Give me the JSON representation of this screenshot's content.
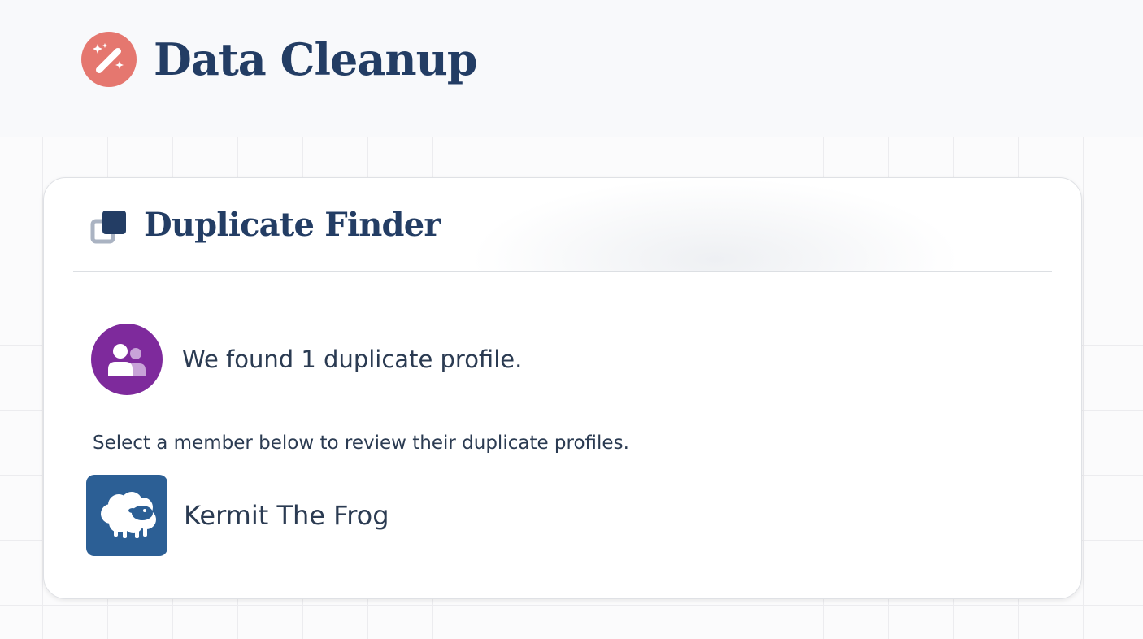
{
  "header": {
    "title": "Data Cleanup",
    "logo_icon": "magic-wand-icon",
    "logo_color": "#e5776f"
  },
  "card": {
    "title": "Duplicate Finder",
    "title_icon": "duplicate-squares-icon",
    "result_icon": "people-group-icon",
    "result_icon_color": "#7e2a9c",
    "result_text": "We found 1 duplicate profile.",
    "instruction": "Select a member below to review their duplicate profiles.",
    "members": [
      {
        "name": "Kermit The Frog",
        "avatar_icon": "sheep-icon",
        "avatar_color": "#2c5f95"
      }
    ]
  },
  "colors": {
    "heading": "#233d64",
    "body_text": "#2b3b52"
  }
}
